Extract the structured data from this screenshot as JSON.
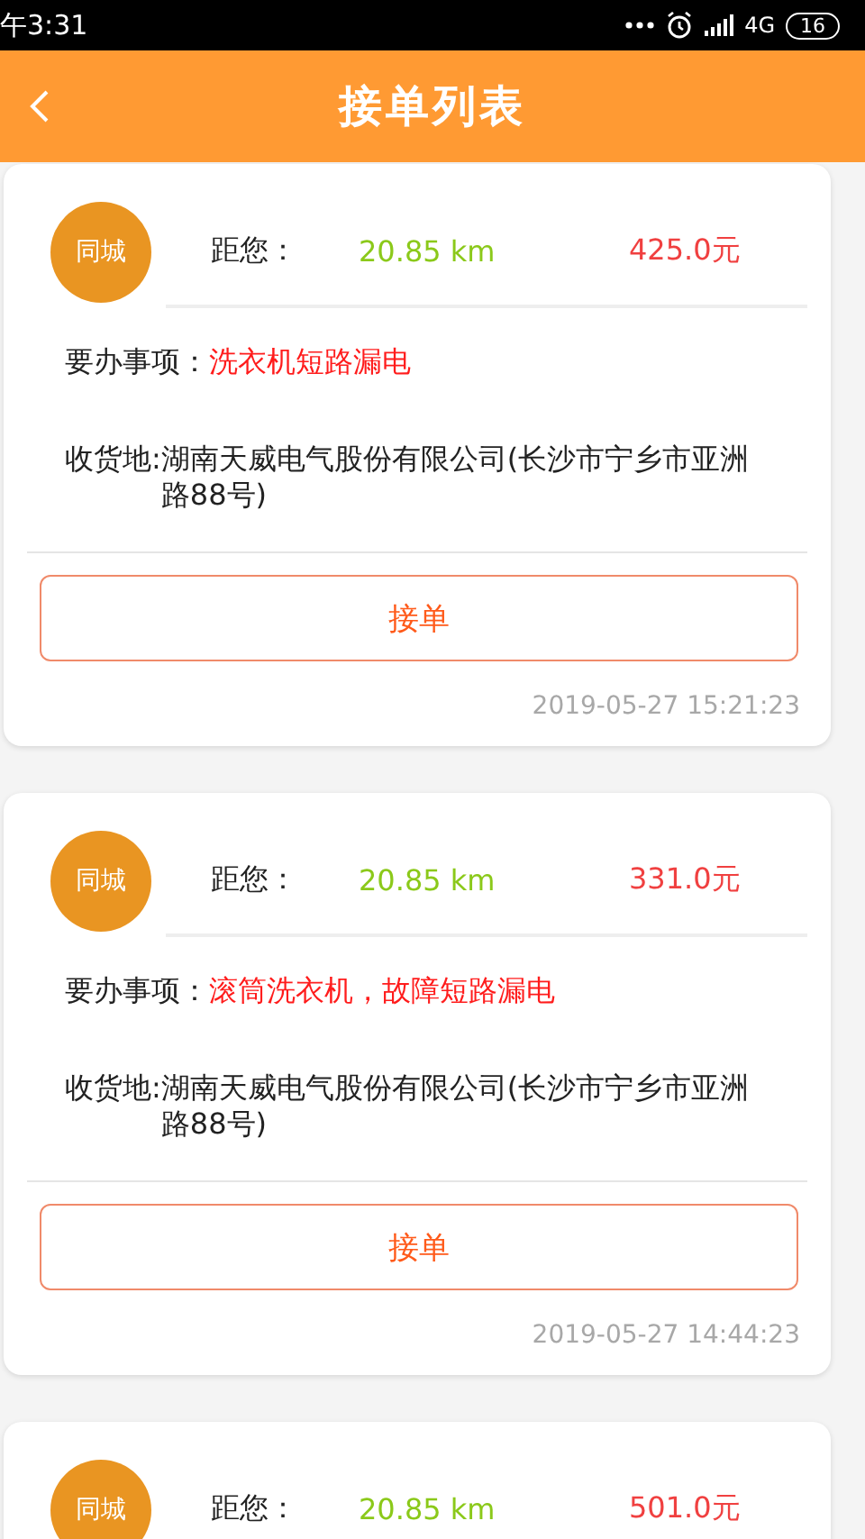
{
  "status_bar": {
    "time": "午3:31",
    "network": "4G",
    "battery": "16"
  },
  "header": {
    "title": "接单列表"
  },
  "orders": [
    {
      "tag": "同城",
      "distance_label": "距您：",
      "distance": "20.85 km",
      "price": "425.0元",
      "task_label": "要办事项：",
      "task": "洗衣机短路漏电",
      "address_label": "收货地:",
      "address": "湖南天威电气股份有限公司(长沙市宁乡市亚洲路88号)",
      "button": "接单",
      "time": "2019-05-27 15:21:23"
    },
    {
      "tag": "同城",
      "distance_label": "距您：",
      "distance": "20.85 km",
      "price": "331.0元",
      "task_label": "要办事项：",
      "task": "滚筒洗衣机，故障短路漏电",
      "address_label": "收货地:",
      "address": "湖南天威电气股份有限公司(长沙市宁乡市亚洲路88号)",
      "button": "接单",
      "time": "2019-05-27 14:44:23"
    },
    {
      "tag": "同城",
      "distance_label": "距您：",
      "distance": "20.85 km",
      "price": "501.0元"
    }
  ]
}
